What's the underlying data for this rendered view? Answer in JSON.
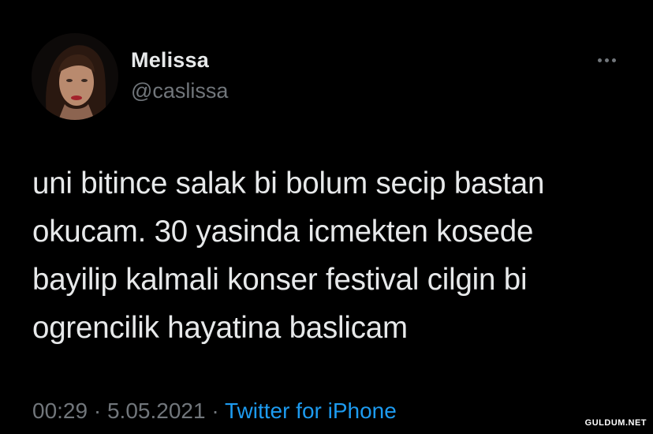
{
  "author": {
    "name": "Melissa",
    "handle": "@caslissa"
  },
  "more_icon": "more-horizontal-icon",
  "tweet": {
    "text": "uni bitince salak bi bolum secip bastan\nokucam. 30 yasinda icmekten kosede\nbayilip kalmali konser festival cilgin bi\nogrencilik hayatina baslicam",
    "time": "00:29",
    "separator": " · ",
    "date": "5.05.2021",
    "source": "Twitter for iPhone"
  },
  "watermark": "GULDUM.NET",
  "colors": {
    "background": "#000000",
    "primary_text": "#e7e9ea",
    "secondary_text": "#71767b",
    "link": "#1d9bf0"
  }
}
